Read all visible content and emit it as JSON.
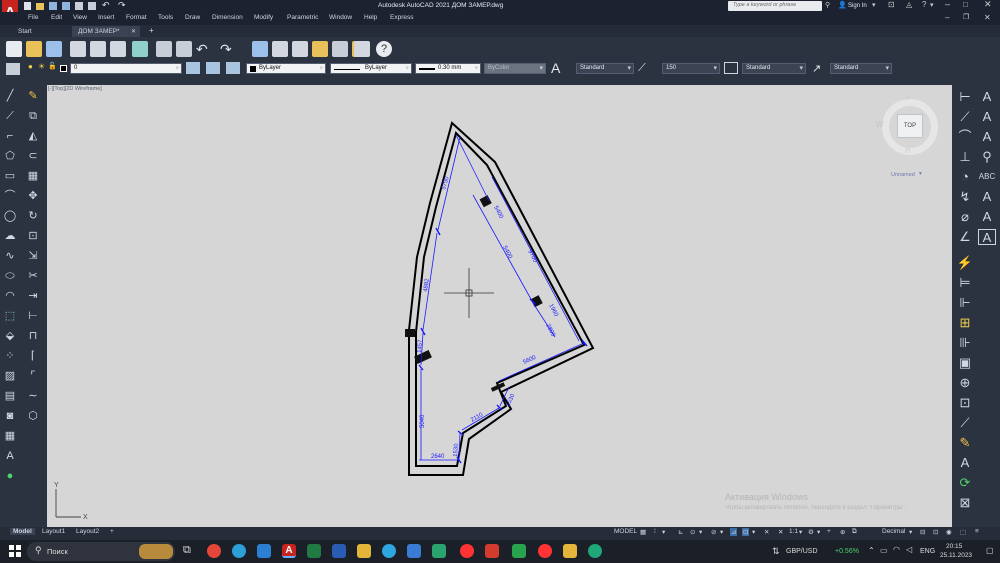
{
  "window": {
    "title": "Autodesk AutoCAD 2021   ДОМ ЗАМЕР.dwg",
    "search_placeholder": "Type a keyword or phrase",
    "sign_in": "Sign In"
  },
  "menu": [
    "File",
    "Edit",
    "View",
    "Insert",
    "Format",
    "Tools",
    "Draw",
    "Dimension",
    "Modify",
    "Parametric",
    "Window",
    "Help",
    "Express"
  ],
  "tabs": [
    {
      "label": "Start"
    },
    {
      "label": "ДОМ ЗАМЕР*"
    },
    {
      "label": "+"
    }
  ],
  "properties": {
    "layer": "0",
    "color": "ByLayer",
    "linetype": "ByLayer",
    "lineweight": "0.30 mm",
    "plotstyle": "ByColor",
    "text_style": "Standard",
    "dim_scale": "150",
    "table_style": "Standard",
    "mleader_style": "Standard"
  },
  "viewport_label": "[-][Top][2D Wireframe]",
  "viewcube": {
    "face": "TOP",
    "west": "W",
    "ucs_label": "Unnamed"
  },
  "drawing": {
    "dimensions": [
      "5750",
      "4882",
      "1457",
      "5040",
      "2640",
      "1530",
      "2110",
      "1530",
      "5400",
      "5400",
      "9700",
      "1960",
      "2800",
      "5600"
    ]
  },
  "ucs": {
    "x": "X",
    "y": "Y"
  },
  "layout_tabs": [
    "Model",
    "Layout1",
    "Layout2",
    "+"
  ],
  "status": {
    "model": "MODEL",
    "scale": "1:1",
    "units": "Decimal"
  },
  "watermark": {
    "title": "Активация Windows",
    "subtitle": "Чтобы активировать Windows, перейдите в раздел \"Параметры\"."
  },
  "taskbar": {
    "search": "Поиск",
    "ticker": "GBP/USD",
    "ticker_change": "+0.56%",
    "language": "ENG",
    "time": "20:15",
    "date": "25.11.2023"
  },
  "colors": {
    "canvas": "#d6d6d6",
    "dimension": "#1a1aff",
    "wall": "#000000",
    "accent_red": "#d9362b",
    "positive": "#4fd16b"
  }
}
